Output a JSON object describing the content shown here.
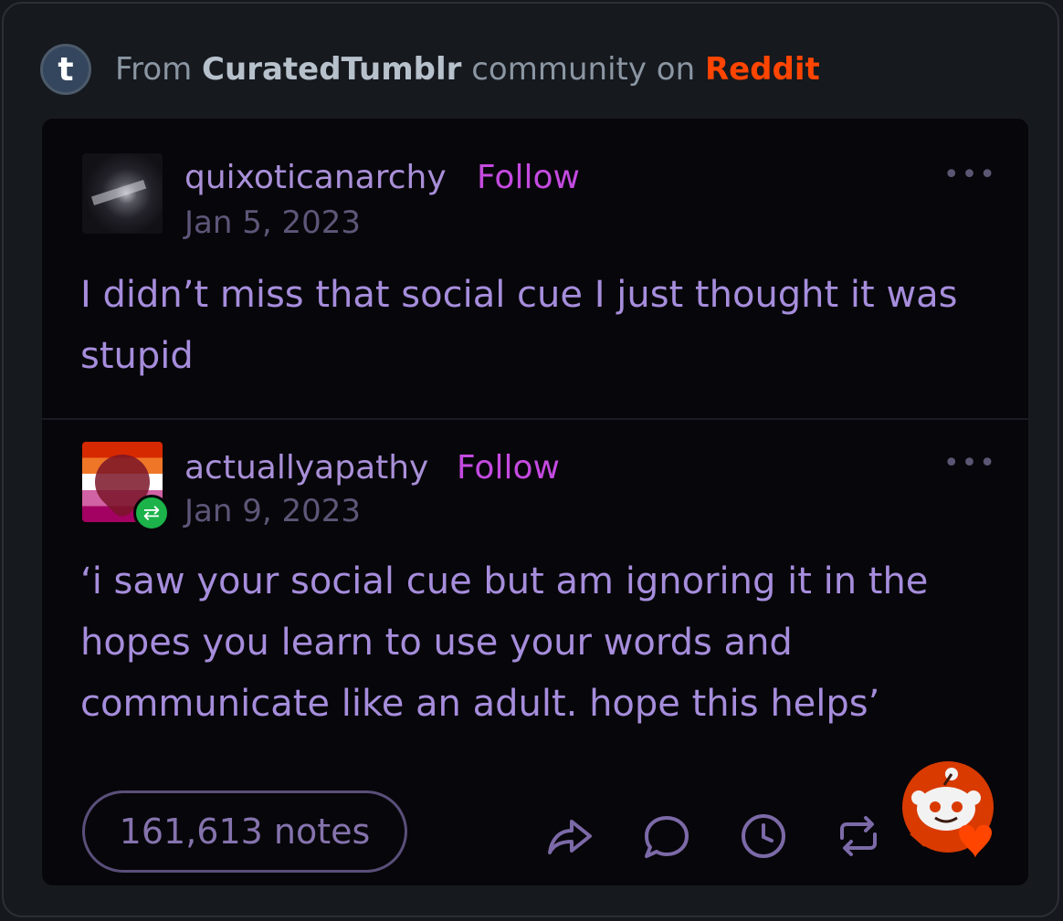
{
  "source": {
    "prefix": "From ",
    "community": "CuratedTumblr",
    "middle": " community on ",
    "platform": "Reddit",
    "logo_letter": "t"
  },
  "posts": [
    {
      "username": "quixoticanarchy",
      "follow_label": "Follow",
      "date": "Jan 5, 2023",
      "more_label": "•••",
      "text": "I didn’t miss that social cue I just thought it was stupid"
    },
    {
      "username": "actuallyapathy",
      "follow_label": "Follow",
      "date": "Jan 9, 2023",
      "more_label": "•••",
      "text": "‘i saw your social cue but am ignoring it in the hopes you learn to use your words and communicate like an adult.  hope this helps’"
    }
  ],
  "footer": {
    "notes": "161,613 notes",
    "actions": [
      "share-icon",
      "comment-icon",
      "clock-icon",
      "reblog-icon"
    ]
  },
  "colors": {
    "accent_reddit": "#ff4500",
    "follow": "#c44ae0",
    "post_text": "#a68ddc",
    "reblog_badge": "#1bb34a"
  }
}
